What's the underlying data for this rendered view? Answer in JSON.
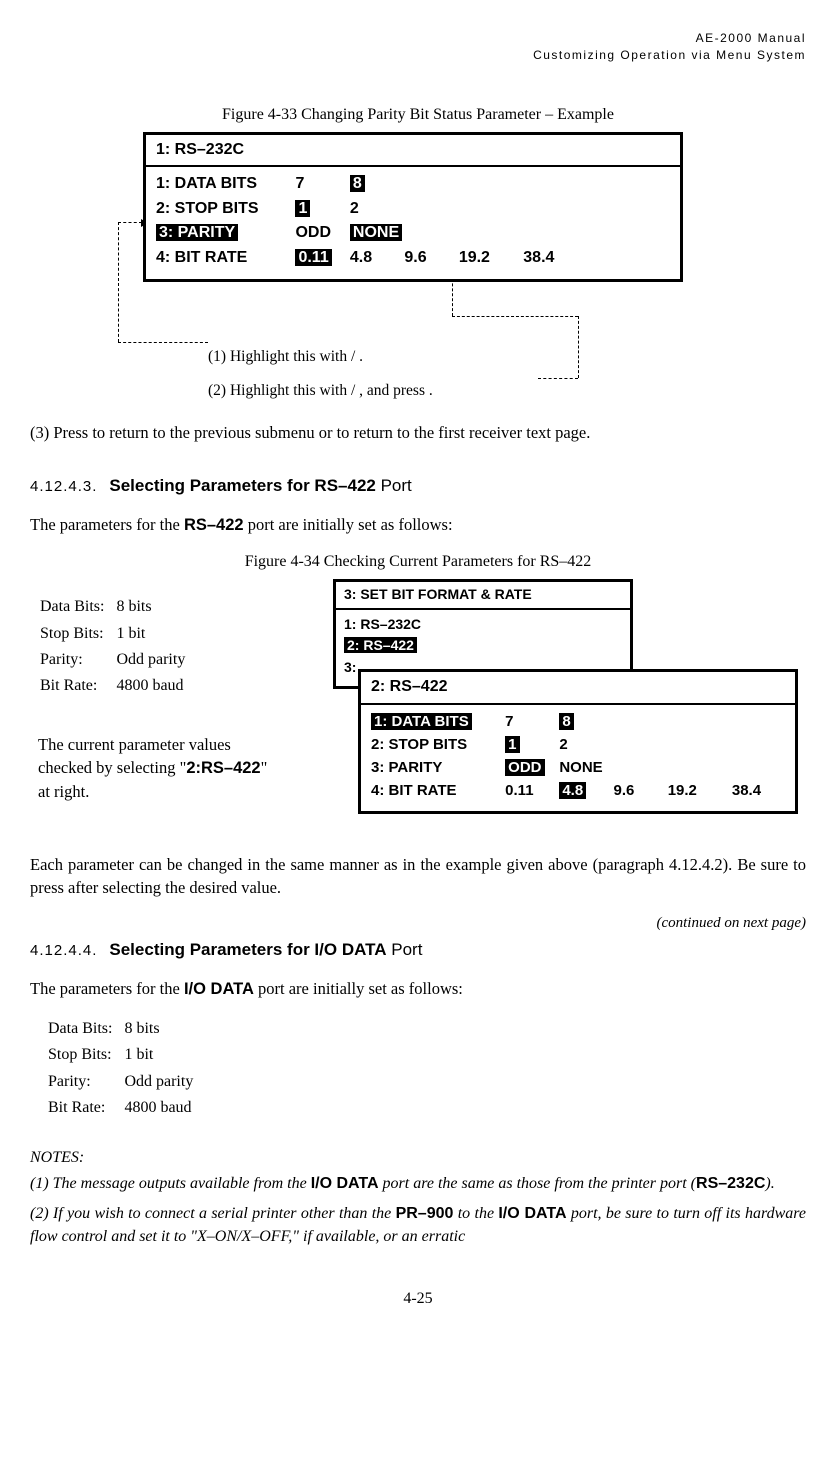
{
  "header": {
    "line1": "AE-2000 Manual",
    "line2": "Customizing Operation via Menu System"
  },
  "fig33": {
    "caption": "Figure 4-33   Changing Parity Bit Status Parameter – Example",
    "title": "1: RS–232C",
    "rows": {
      "r1": {
        "label": "1: DATA BITS",
        "opt1": "7",
        "opt2": "8"
      },
      "r2": {
        "label": "2: STOP BITS",
        "opt1": "1",
        "opt2": "2"
      },
      "r3": {
        "label": "3: PARITY",
        "opt1": "ODD",
        "opt2": "NONE"
      },
      "r4": {
        "label": "4: BIT RATE",
        "opt1": "0.11",
        "opt2": "4.8",
        "opt3": "9.6",
        "opt4": "19.2",
        "opt5": "38.4"
      }
    },
    "step1": "(1) Highlight this with       /     .",
    "step2a": "(2) Highlight this with      /   , and press       .",
    "step3": "(3) Press         to return to the previous submenu or         to return to the first receiver text page."
  },
  "sect4_12_4_3": {
    "num": "4.12.4.3.",
    "title": "Selecting Parameters for RS–422",
    "suffix": "Port",
    "para1a": "The parameters for the ",
    "para1b": "RS–422",
    "para1c": " port are initially set as follows:"
  },
  "fig34": {
    "caption": "Figure 4-34   Checking Current Parameters for RS–422",
    "defs": {
      "k1": "Data Bits:",
      "v1": "8 bits",
      "k2": "Stop Bits:",
      "v2": "1 bit",
      "k3": "Parity:",
      "v3": "Odd parity",
      "k4": "Bit Rate:",
      "v4": "4800 baud"
    },
    "box1": {
      "title": "3: SET BIT FORMAT & RATE",
      "r1": "1: RS–232C",
      "r2": "2: RS–422",
      "r3": "3:"
    },
    "box2": {
      "title": "2: RS–422",
      "rows": {
        "r1": {
          "label": "1: DATA BITS",
          "opt1": "7",
          "opt2": "8"
        },
        "r2": {
          "label": "2: STOP BITS",
          "opt1": "1",
          "opt2": "2"
        },
        "r3": {
          "label": "3: PARITY",
          "opt1": "ODD",
          "opt2": "NONE"
        },
        "r4": {
          "label": "4: BIT RATE",
          "opt1": "0.11",
          "opt2": "4.8",
          "opt3": "9.6",
          "opt4": "19.2",
          "opt5": "38.4"
        }
      }
    },
    "midpara_a": "The current parameter values",
    "midpara_b": "checked by selecting \"",
    "midpara_c": "2:RS–422",
    "midpara_d": "\"",
    "midpara_e": "at right."
  },
  "para_each": "Each parameter can be changed in the same manner as in the example given above (paragraph 4.12.4.2). Be sure to press        after selecting the desired value.",
  "cont": "(continued on next page)",
  "sect4_12_4_4": {
    "num": "4.12.4.4.",
    "title": "Selecting Parameters for I/O DATA",
    "suffix": "Port",
    "para1a": "The parameters for the ",
    "para1b": "I/O DATA",
    "para1c": " port are initially set as follows:"
  },
  "defs2": {
    "k1": "Data Bits:",
    "v1": "8 bits",
    "k2": "Stop Bits:",
    "v2": "1 bit",
    "k3": "Parity:",
    "v3": "Odd parity",
    "k4": "Bit Rate:",
    "v4": "4800 baud"
  },
  "notes": {
    "hd": "NOTES:",
    "n1a": "(1) The message outputs available from the ",
    "n1b": "I/O DATA",
    "n1c": " port are the same as those from the printer port (",
    "n1d": "RS–232C",
    "n1e": ").",
    "n2a": "(2) If you wish to connect a serial printer other than the ",
    "n2b": "PR–900",
    "n2c": " to the ",
    "n2d": "I/O DATA",
    "n2e": " port, be sure to turn off its hardware flow control and set it to \"X–ON/X–OFF,\" if available, or an erratic"
  },
  "page_num": "4-25"
}
